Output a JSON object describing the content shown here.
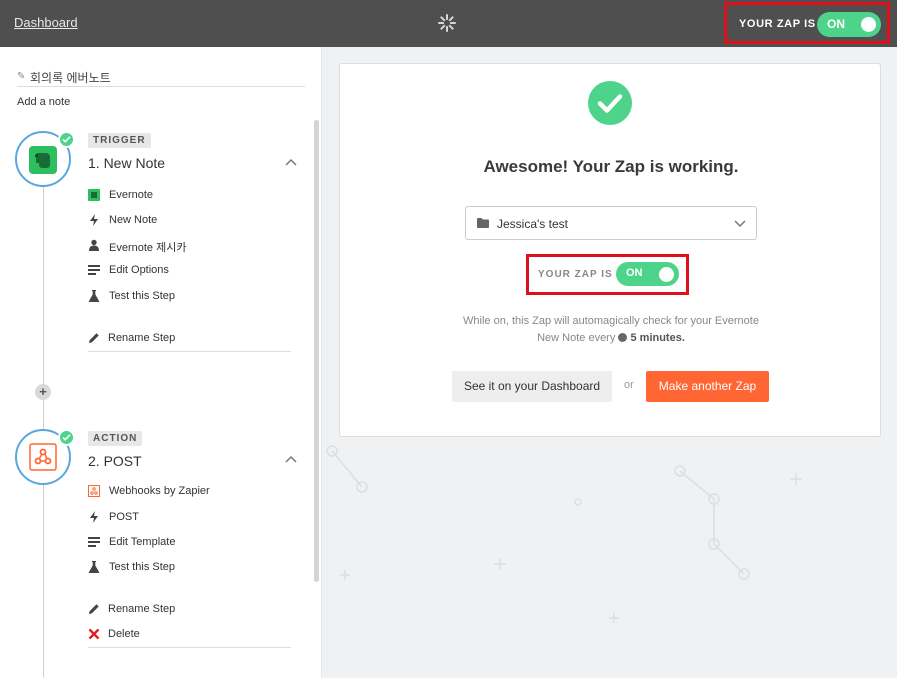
{
  "header": {
    "dashboard_link": "Dashboard",
    "status_label": "YOUR ZAP IS",
    "toggle_label": "ON"
  },
  "sidebar": {
    "zap_name": "회의록 에버노트",
    "add_note": "Add a note",
    "trigger": {
      "tag": "TRIGGER",
      "title": "1. New Note",
      "items": [
        {
          "icon": "evernote-icon",
          "label": "Evernote"
        },
        {
          "icon": "bolt-icon",
          "label": "New Note"
        },
        {
          "icon": "user-icon",
          "label": "Evernote 제시카"
        },
        {
          "icon": "list-icon",
          "label": "Edit Options"
        },
        {
          "icon": "flask-icon",
          "label": "Test this Step"
        }
      ],
      "rename": "Rename Step"
    },
    "action": {
      "tag": "ACTION",
      "title": "2. POST",
      "items": [
        {
          "icon": "webhooks-icon",
          "label": "Webhooks by Zapier"
        },
        {
          "icon": "bolt-icon",
          "label": "POST"
        },
        {
          "icon": "list-icon",
          "label": "Edit Template"
        },
        {
          "icon": "flask-icon",
          "label": "Test this Step"
        }
      ],
      "rename": "Rename Step",
      "delete": "Delete"
    }
  },
  "card": {
    "title": "Awesome! Your Zap is working.",
    "folder": "Jessica's test",
    "status_label": "YOUR ZAP IS",
    "toggle_label": "ON",
    "desc_line1": "While on, this Zap will automagically check for your Evernote",
    "desc_prefix": "New Note every",
    "desc_interval": "5 minutes.",
    "dashboard_button": "See it on your Dashboard",
    "or": "or",
    "another_button": "Make another Zap"
  },
  "colors": {
    "accent_green": "#4ed38b",
    "highlight_red": "#e0101a",
    "cta_orange": "#ff6633",
    "header_bg": "#4f4f50"
  }
}
